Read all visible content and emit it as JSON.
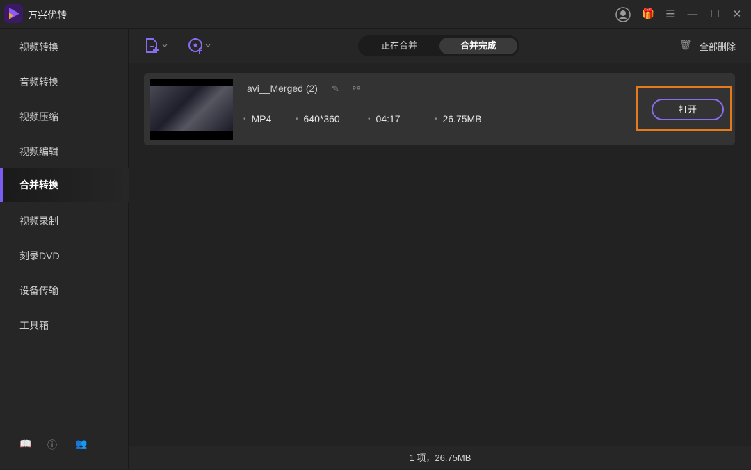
{
  "app": {
    "title": "万兴优转"
  },
  "sidebar": {
    "items": [
      {
        "label": "视频转换"
      },
      {
        "label": "音频转换"
      },
      {
        "label": "视频压缩"
      },
      {
        "label": "视频编辑"
      },
      {
        "label": "合并转换"
      },
      {
        "label": "视频录制"
      },
      {
        "label": "刻录DVD"
      },
      {
        "label": "设备传输"
      },
      {
        "label": "工具箱"
      }
    ],
    "active": "合并转换"
  },
  "tabs": {
    "merging": "正在合并",
    "done": "合并完成"
  },
  "toolbar": {
    "delete_all": "全部删除"
  },
  "file": {
    "name": "avi__Merged (2)",
    "format": "MP4",
    "resolution": "640*360",
    "duration": "04:17",
    "size": "26.75MB",
    "open_label": "打开"
  },
  "status": {
    "summary": "1 项，26.75MB"
  },
  "colors": {
    "accent": "#7b5cf0",
    "highlight": "#e57a1c"
  }
}
